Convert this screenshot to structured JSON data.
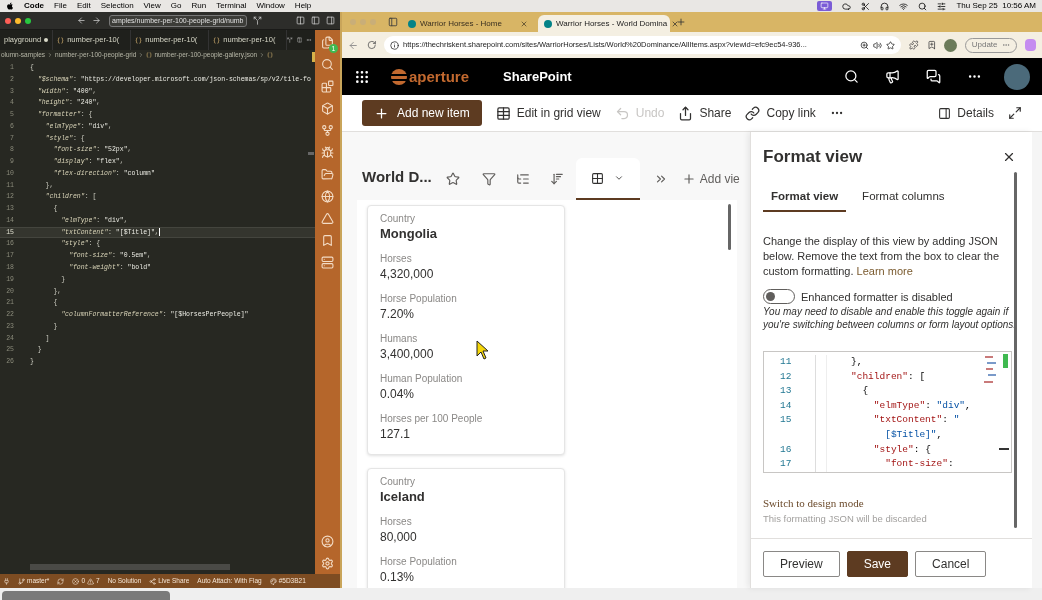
{
  "menu_bar": {
    "app": "Code",
    "menus": [
      "File",
      "Edit",
      "Selection",
      "View",
      "Go",
      "Run",
      "Terminal",
      "Window",
      "Help"
    ],
    "clock": "Thu Sep 25  10:56 AM"
  },
  "editor_window": {
    "command_center": "amples/number-per-100-people-grid/numb",
    "tabs": [
      {
        "label": "playground",
        "modified": true
      },
      {
        "label": "number-per-10(",
        "modified": false
      },
      {
        "label": "number-per-10(",
        "modified": false
      },
      {
        "label": "number-per-10(",
        "modified": false
      }
    ],
    "breadcrumb": [
      "olumn-samples",
      "number-per-100-people-grid",
      "number-per-100-people-gallery.json"
    ],
    "activity_badge": "1",
    "code_lines": [
      {
        "n": "1",
        "text": "{",
        "current": false
      },
      {
        "n": "2",
        "text": "  \"$schema\": \"https://developer.microsoft.com/json-schemas/sp/v2/tile-fo",
        "current": false
      },
      {
        "n": "3",
        "text": "  \"width\": \"400\",",
        "current": false
      },
      {
        "n": "4",
        "text": "  \"height\": \"240\",",
        "current": false
      },
      {
        "n": "5",
        "text": "  \"formatter\": {",
        "current": false
      },
      {
        "n": "6",
        "text": "    \"elmType\": \"div\",",
        "current": false
      },
      {
        "n": "7",
        "text": "    \"style\": {",
        "current": false
      },
      {
        "n": "8",
        "text": "      \"font-size\": \"52px\",",
        "current": false
      },
      {
        "n": "9",
        "text": "      \"display\": \"flex\",",
        "current": false
      },
      {
        "n": "10",
        "text": "      \"flex-direction\": \"column\"",
        "current": false
      },
      {
        "n": "11",
        "text": "    },",
        "current": false
      },
      {
        "n": "12",
        "text": "    \"children\": [",
        "current": false
      },
      {
        "n": "13",
        "text": "      {",
        "current": false
      },
      {
        "n": "14",
        "text": "        \"elmType\": \"div\",",
        "current": false
      },
      {
        "n": "15",
        "text": "        \"txtContent\": \"[$Title]\",",
        "current": true
      },
      {
        "n": "16",
        "text": "        \"style\": {",
        "current": false
      },
      {
        "n": "17",
        "text": "          \"font-size\": \"0.5em\",",
        "current": false
      },
      {
        "n": "18",
        "text": "          \"font-weight\": \"bold\"",
        "current": false
      },
      {
        "n": "19",
        "text": "        }",
        "current": false
      },
      {
        "n": "20",
        "text": "      },",
        "current": false
      },
      {
        "n": "21",
        "text": "      {",
        "current": false
      },
      {
        "n": "22",
        "text": "        \"columnFormatterReference\": \"[$HorsesPerPeople]\"",
        "current": false
      },
      {
        "n": "23",
        "text": "      }",
        "current": false
      },
      {
        "n": "24",
        "text": "    ]",
        "current": false
      },
      {
        "n": "25",
        "text": "  }",
        "current": false
      },
      {
        "n": "26",
        "text": "}",
        "current": false
      }
    ],
    "status_bar": {
      "branch": "master*",
      "errors": "0",
      "warnings": "7",
      "solution": "No Solution",
      "live_share": "Live Share",
      "auto_attach": "Auto Attach: With Flag",
      "color_label": "#5D3B21"
    }
  },
  "browser": {
    "tabs": [
      {
        "title": "Warrior Horses - Home",
        "selected": false
      },
      {
        "title": "Warrior Horses - World Domina",
        "selected": true
      }
    ],
    "url": "https://thechriskent.sharepoint.com/sites/WarriorHorses/Lists/World%20Dominance/AllItems.aspx?viewid=efc9ec54-936...",
    "update_button": "Update"
  },
  "sharepoint": {
    "logo": "aperture",
    "app_name": "SharePoint",
    "commands": [
      {
        "kind": "primary",
        "label": "Add new item",
        "disabled": false
      },
      {
        "kind": "grid",
        "label": "Edit in grid view",
        "disabled": false
      },
      {
        "kind": "undo",
        "label": "Undo",
        "disabled": true
      },
      {
        "kind": "share",
        "label": "Share",
        "disabled": false
      },
      {
        "kind": "link",
        "label": "Copy link",
        "disabled": false
      }
    ],
    "details": "Details",
    "list_title": "World D...",
    "add_view": "Add vie",
    "cards": [
      {
        "fields": [
          {
            "label": "Country",
            "value": "Mongolia",
            "kind": "title"
          },
          {
            "label": "Horses",
            "value": "4,320,000",
            "kind": "plain"
          },
          {
            "label": "Horse Population",
            "value": "7.20%",
            "kind": "plain"
          },
          {
            "label": "Humans",
            "value": "3,400,000",
            "kind": "plain"
          },
          {
            "label": "Human Population",
            "value": "0.04%",
            "kind": "plain"
          },
          {
            "label": "Horses per 100 People",
            "value": "127.1",
            "kind": "plain"
          }
        ]
      },
      {
        "fields": [
          {
            "label": "Country",
            "value": "Iceland",
            "kind": "title"
          },
          {
            "label": "Horses",
            "value": "80,000",
            "kind": "plain"
          },
          {
            "label": "Horse Population",
            "value": "0.13%",
            "kind": "plain"
          }
        ]
      }
    ]
  },
  "format_pane": {
    "title": "Format view",
    "tabs": [
      {
        "label": "Format view",
        "selected": true
      },
      {
        "label": "Format columns",
        "selected": false
      }
    ],
    "description": "Change the display of this view by adding JSON below. Remove the text from the box to clear the custom formatting.",
    "learn_more": "Learn more",
    "toggle": {
      "label": "Enhanced formatter is disabled",
      "on": false
    },
    "note": "You may need to disable and enable this toggle again if you're switching between columns or form layout options.",
    "code_lines": [
      {
        "n": "11",
        "text": "},",
        "kind": "line"
      },
      {
        "n": "12",
        "text": "\"children\": [",
        "kind": "line"
      },
      {
        "n": "13",
        "text": "  {",
        "kind": "line"
      },
      {
        "n": "14",
        "text": "    \"elmType\": \"div\",",
        "kind": "line"
      },
      {
        "n": "15",
        "text": "    \"txtContent\": \"",
        "kind": "line"
      },
      {
        "text": "      [$Title]\",",
        "kind": "wrap"
      },
      {
        "n": "16",
        "text": "    \"style\": {",
        "kind": "line"
      },
      {
        "n": "17",
        "text": "      \"font-size\":",
        "kind": "line"
      }
    ],
    "design_mode_link": "Switch to design mode",
    "discard_note": "This formatting JSON will be discarded",
    "buttons": [
      {
        "label": "Preview",
        "kind": "secondary"
      },
      {
        "label": "Save",
        "kind": "primary"
      },
      {
        "label": "Cancel",
        "kind": "secondary"
      }
    ]
  }
}
